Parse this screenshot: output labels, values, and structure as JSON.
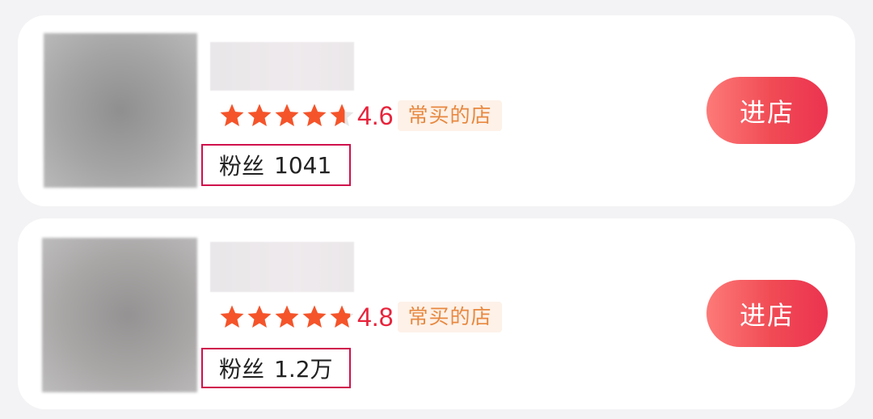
{
  "shops": [
    {
      "rating": 4.6,
      "rating_text": "4.6",
      "badge": "常买的店",
      "fans_label": "粉丝",
      "fans_count": "1041",
      "button_label": "进店"
    },
    {
      "rating": 4.8,
      "rating_text": "4.8",
      "badge": "常买的店",
      "fans_label": "粉丝",
      "fans_count": "1.2万",
      "button_label": "进店"
    }
  ],
  "colors": {
    "star_filled": "#f5542a",
    "star_empty": "#e6e6e6",
    "score": "#e8233b",
    "badge_bg": "#fdf1e8",
    "badge_text": "#e8883f",
    "highlight_border": "#d0104c",
    "button_start": "#fd7a78",
    "button_end": "#ec3350"
  },
  "icons": {
    "star": "star-icon"
  }
}
